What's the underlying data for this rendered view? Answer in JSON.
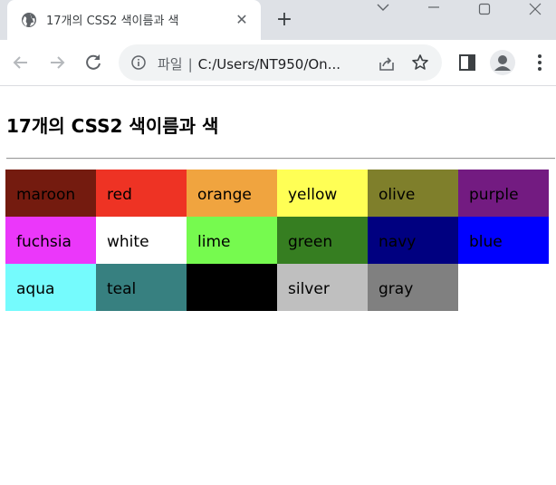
{
  "browser": {
    "tab_title": "17개의 CSS2 색이름과 색",
    "tab_close": "✕",
    "new_tab": "+",
    "address_scheme": "파일",
    "address_sep": "|",
    "address_url": "C:/Users/NT950/On..."
  },
  "page": {
    "title": "17개의 CSS2 색이름과 색",
    "rows": [
      [
        {
          "name": "maroon",
          "color": "#741b0f"
        },
        {
          "name": "red",
          "color": "#ee3324"
        },
        {
          "name": "orange",
          "color": "#f0a43f"
        },
        {
          "name": "yellow",
          "color": "#ffff55"
        },
        {
          "name": "olive",
          "color": "#7f7f2b"
        },
        {
          "name": "purple",
          "color": "#731b81"
        }
      ],
      [
        {
          "name": "fuchsia",
          "color": "#eb37fa"
        },
        {
          "name": "white",
          "color": "#ffffff"
        },
        {
          "name": "lime",
          "color": "#76fa4f"
        },
        {
          "name": "green",
          "color": "#367e21"
        },
        {
          "name": "navy",
          "color": "#000080"
        },
        {
          "name": "blue",
          "color": "#0000ff"
        }
      ],
      [
        {
          "name": "aqua",
          "color": "#75fbfd"
        },
        {
          "name": "teal",
          "color": "#378080"
        },
        {
          "name": "",
          "color": "#000000"
        },
        {
          "name": "silver",
          "color": "#bfbfbf"
        },
        {
          "name": "gray",
          "color": "#808080"
        }
      ]
    ]
  }
}
